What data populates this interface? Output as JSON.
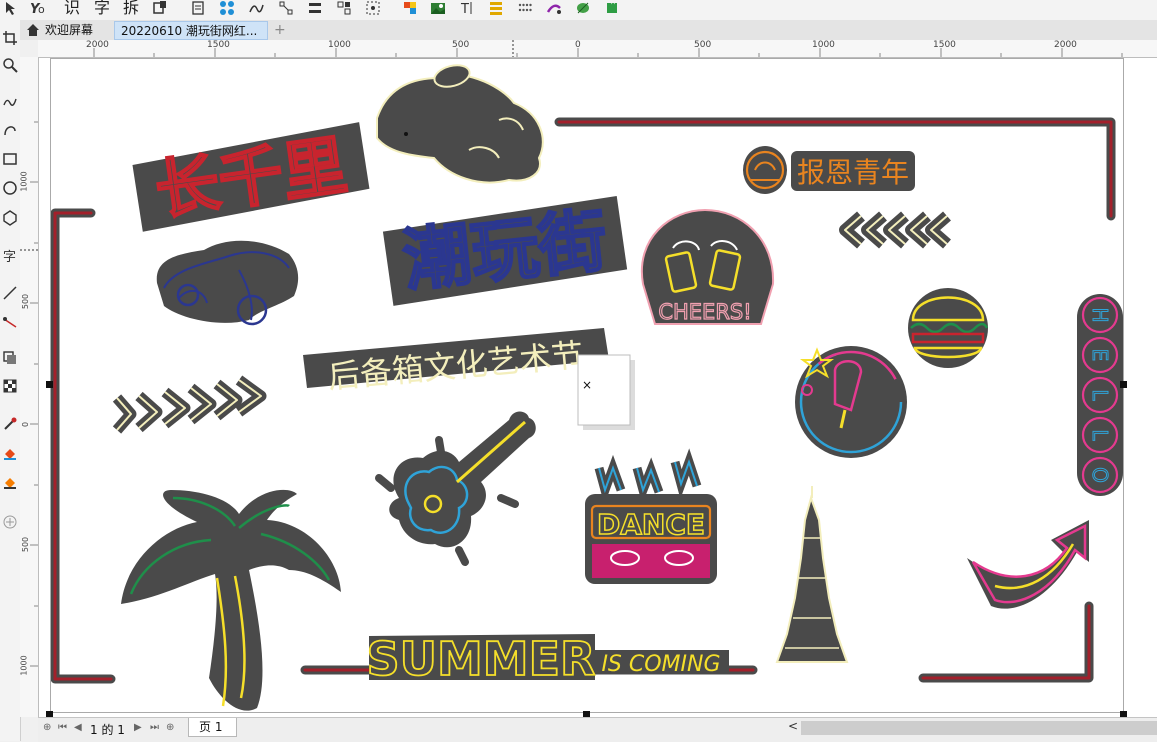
{
  "toolbar": {
    "text_buttons": [
      "识",
      "字",
      "拆"
    ],
    "icons": [
      "pointer-icon",
      "text-tool-icon",
      "frame-icon",
      "grid-icon",
      "align-icon",
      "node-icon",
      "dimension-icon",
      "fill-icon",
      "transform-icon",
      "bars-icon",
      "dots-icon",
      "wand-icon",
      "green-puzzle-icon"
    ]
  },
  "tabs": [
    {
      "label": "欢迎屏幕"
    },
    {
      "label": "20220610 潮玩街网红..."
    }
  ],
  "add_tab_label": "+",
  "ruler": {
    "h_labels": [
      "2000",
      "1500",
      "1000",
      "500",
      "0",
      "500",
      "1000",
      "1500",
      "2000"
    ],
    "v_labels": [
      "1000",
      "500",
      "0",
      "500",
      "1000"
    ]
  },
  "artwork": {
    "t_changqianli": "长千里",
    "t_chaowanjie": "潮玩街",
    "t_houbeixiang": "后备箱文化艺术节",
    "t_baoen": "报恩青年",
    "t_cheers": "CHEERS!",
    "t_dance": "DANCE",
    "t_summer": "SUMMER",
    "t_is_coming": "IS COMING",
    "t_hello": [
      "H",
      "E",
      "L",
      "L",
      "O"
    ],
    "placeholder_mark": "×"
  },
  "statusbar": {
    "page_counter": "1 的 1",
    "page_tab": "页 1",
    "scroll_left": "<"
  },
  "colors": {
    "neon_dark": "#4a4a4a",
    "neon_red": "#c8242e",
    "neon_blue": "#2b3790",
    "neon_cream": "#f3eebc",
    "neon_yellow": "#f5df2a",
    "neon_orange": "#e9841f",
    "neon_pink": "#e43a8f",
    "neon_cyan": "#2fa3d8",
    "neon_green": "#1f8f4a",
    "frame_red": "#a3202b"
  }
}
